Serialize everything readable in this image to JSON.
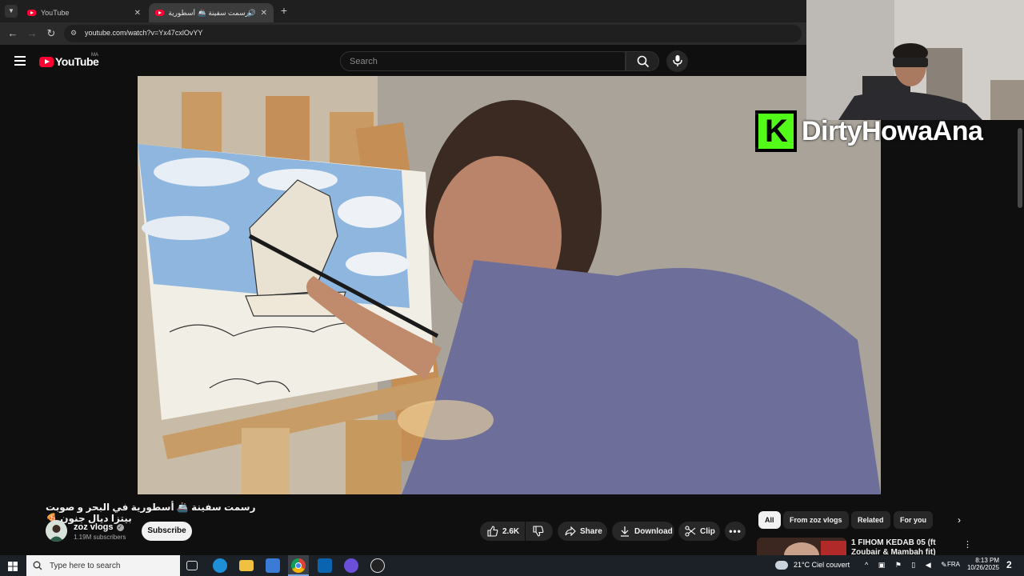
{
  "browser": {
    "tabs": [
      {
        "title": "YouTube"
      },
      {
        "title": "رسمت سفينة 🚢 أسطورية ف"
      }
    ],
    "new_tab_symbol": "+",
    "url": "youtube.com/watch?v=Yx47cxlOvYY"
  },
  "youtube": {
    "logo_text": "YouTube",
    "country_code": "MA",
    "search_placeholder": "Search"
  },
  "overlay": {
    "streamer_name": "DirtyHowaAna",
    "kick_letter": "K",
    "kick_color": "#53fc18"
  },
  "video": {
    "title": "رسمت سفينة 🚢 أسطورية في البحر و صوبت بيتزا ديال جنون 🍕",
    "channel_name": "zoz vlogs",
    "subscribers": "1.19M subscribers",
    "subscribe_label": "Subscribe",
    "likes": "2.6K",
    "share_label": "Share",
    "download_label": "Download",
    "clip_label": "Clip"
  },
  "sidebar": {
    "chips": [
      {
        "label": "All",
        "active": true
      },
      {
        "label": "From zoz vlogs",
        "active": false
      },
      {
        "label": "Related",
        "active": false
      },
      {
        "label": "For you",
        "active": false
      }
    ],
    "first_related_title": "1 FIHOM KEDAB 05 (ft Zoubair & Mambah fit)"
  },
  "taskbar": {
    "search_placeholder": "Type here to search",
    "weather": "21°C Ciel couvert",
    "language": "FRA",
    "time": "8:13 PM",
    "date": "10/26/2025",
    "notification_count": "2"
  }
}
